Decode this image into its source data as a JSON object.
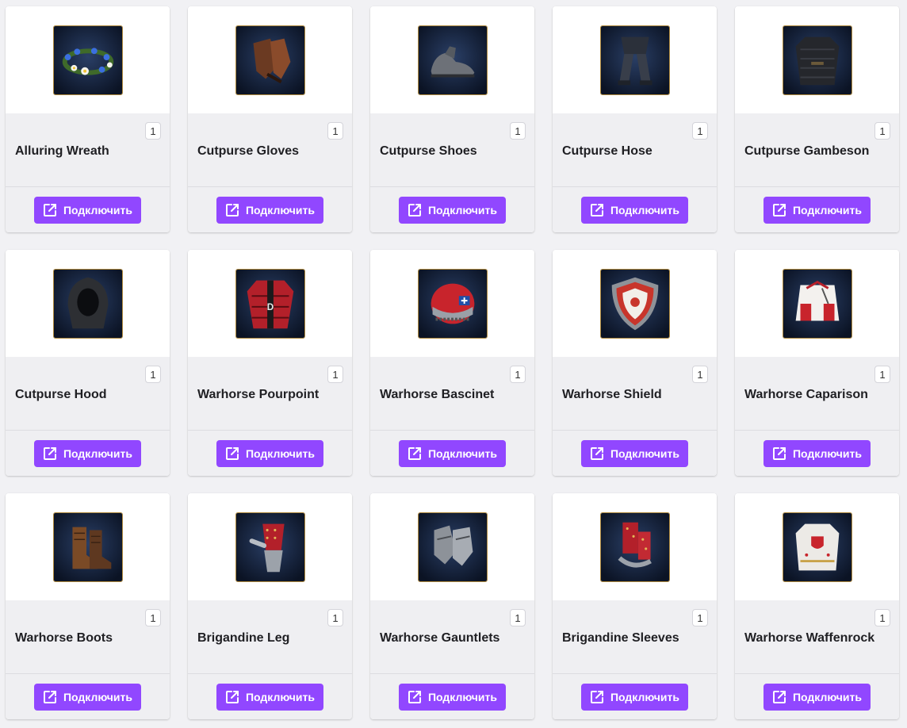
{
  "accent_color": "#9147ff",
  "items": [
    {
      "name": "Alluring Wreath",
      "quantity": "1",
      "button_label": "Подключить",
      "icon": "wreath-icon"
    },
    {
      "name": "Cutpurse Gloves",
      "quantity": "1",
      "button_label": "Подключить",
      "icon": "gloves-icon"
    },
    {
      "name": "Cutpurse Shoes",
      "quantity": "1",
      "button_label": "Подключить",
      "icon": "shoes-icon"
    },
    {
      "name": "Cutpurse Hose",
      "quantity": "1",
      "button_label": "Подключить",
      "icon": "hose-icon"
    },
    {
      "name": "Cutpurse Gambeson",
      "quantity": "1",
      "button_label": "Подключить",
      "icon": "gambeson-icon"
    },
    {
      "name": "Cutpurse Hood",
      "quantity": "1",
      "button_label": "Подключить",
      "icon": "hood-icon"
    },
    {
      "name": "Warhorse Pourpoint",
      "quantity": "1",
      "button_label": "Подключить",
      "icon": "pourpoint-icon"
    },
    {
      "name": "Warhorse Bascinet",
      "quantity": "1",
      "button_label": "Подключить",
      "icon": "helmet-icon"
    },
    {
      "name": "Warhorse Shield",
      "quantity": "1",
      "button_label": "Подключить",
      "icon": "shield-icon"
    },
    {
      "name": "Warhorse Caparison",
      "quantity": "1",
      "button_label": "Подключить",
      "icon": "caparison-icon"
    },
    {
      "name": "Warhorse Boots",
      "quantity": "1",
      "button_label": "Подключить",
      "icon": "boots-icon"
    },
    {
      "name": "Brigandine Leg",
      "quantity": "1",
      "button_label": "Подключить",
      "icon": "leg-armor-icon"
    },
    {
      "name": "Warhorse Gauntlets",
      "quantity": "1",
      "button_label": "Подключить",
      "icon": "gauntlets-icon"
    },
    {
      "name": "Brigandine Sleeves",
      "quantity": "1",
      "button_label": "Подключить",
      "icon": "sleeves-icon"
    },
    {
      "name": "Warhorse Waffenrock",
      "quantity": "1",
      "button_label": "Подключить",
      "icon": "waffenrock-icon"
    }
  ]
}
